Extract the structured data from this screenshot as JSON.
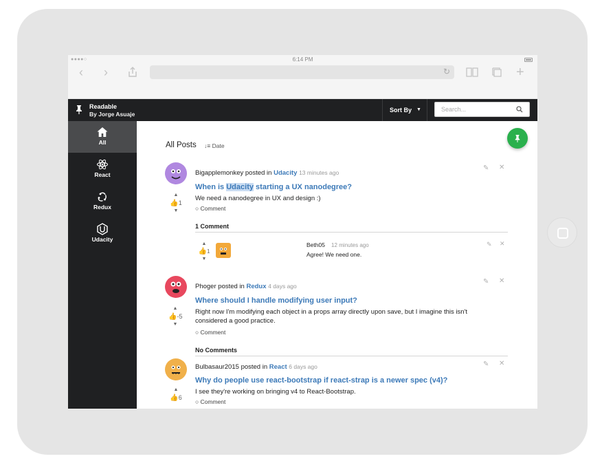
{
  "browser": {
    "time": "6:14 PM",
    "signal_dots": "●●●●○"
  },
  "app": {
    "brand_title": "Readable",
    "brand_subtitle": "By Jorge Asuaje",
    "sort_label": "Sort By",
    "search_placeholder": "Search..."
  },
  "sidebar": {
    "items": [
      {
        "label": "All",
        "icon": "home-icon",
        "active": true
      },
      {
        "label": "React",
        "icon": "react-icon",
        "active": false
      },
      {
        "label": "Redux",
        "icon": "redux-icon",
        "active": false
      },
      {
        "label": "Udacity",
        "icon": "udacity-icon",
        "active": false
      }
    ]
  },
  "main": {
    "heading": "All Posts",
    "sort_value": "Date"
  },
  "posts": [
    {
      "author": "Bigapplemonkey",
      "posted_in": "posted in",
      "category": "Udacity",
      "time_ago": "13 minutes ago",
      "title_pre": "When is ",
      "title_highlight": "Udacity",
      "title_post": " starting a UX nanodegree?",
      "body": "We need a nanodegree in UX and design :)",
      "votes": "1",
      "comment_link": "Comment",
      "comments_header": "1 Comment",
      "avatar_color": "#b088e0"
    },
    {
      "author": "Phoger",
      "posted_in": "posted in",
      "category": "Redux",
      "time_ago": "4 days ago",
      "title": "Where should I handle modifying user input?",
      "body": "Right now I'm modifying each object in a props array directly upon save, but I imagine this isn't considered a good practice.",
      "votes": "-5",
      "comment_link": "Comment",
      "comments_header": "No Comments",
      "avatar_color": "#e8485e"
    },
    {
      "author": "Bulbasaur2015",
      "posted_in": "posted in",
      "category": "React",
      "time_ago": "6 days ago",
      "title": "Why do people use react-bootstrap if react-strap is a newer spec (v4)?",
      "body": "I see they're working on bringing v4 to React-Bootstrap.",
      "votes": "6",
      "comment_link": "Comment",
      "avatar_color": "#f0b04a"
    }
  ],
  "comment": {
    "author": "Beth05",
    "time_ago": "12 minutes ago",
    "body": "Agree! We need one.",
    "votes": "1",
    "avatar_color": "#f2a83a"
  },
  "colors": {
    "accent": "#3d7ab8",
    "fab": "#2ab04d",
    "dark": "#1f2022"
  }
}
